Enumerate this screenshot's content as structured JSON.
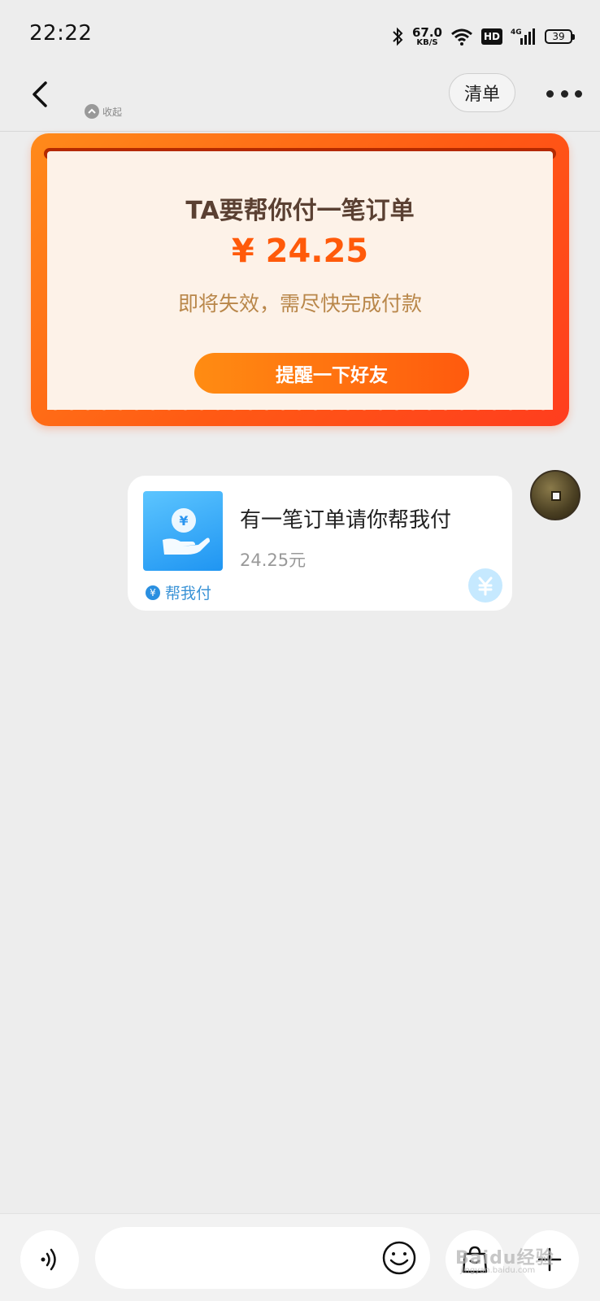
{
  "status_bar": {
    "time": "22:22",
    "net_speed": "67.0",
    "net_unit": "KB/S",
    "hd": "HD",
    "signal": "4G",
    "battery": "39"
  },
  "nav": {
    "collapse_label": "收起",
    "list_label": "清单"
  },
  "promo": {
    "title": "TA要帮你付一笔订单",
    "amount": "¥ 24.25",
    "subtitle": "即将失效，需尽快完成付款",
    "button_label": "提醒一下好友"
  },
  "message": {
    "title": "有一笔订单请你帮我付",
    "amount": "24.25元",
    "source_label": "帮我付"
  },
  "input_bar": {
    "placeholder": ""
  },
  "watermark": {
    "text": "Baidu经验",
    "url": "jingyan.baidu.com"
  },
  "colors": {
    "accent": "#ff5a0a",
    "promo_frame": "#ff6a14",
    "link_blue": "#3a93d6"
  }
}
